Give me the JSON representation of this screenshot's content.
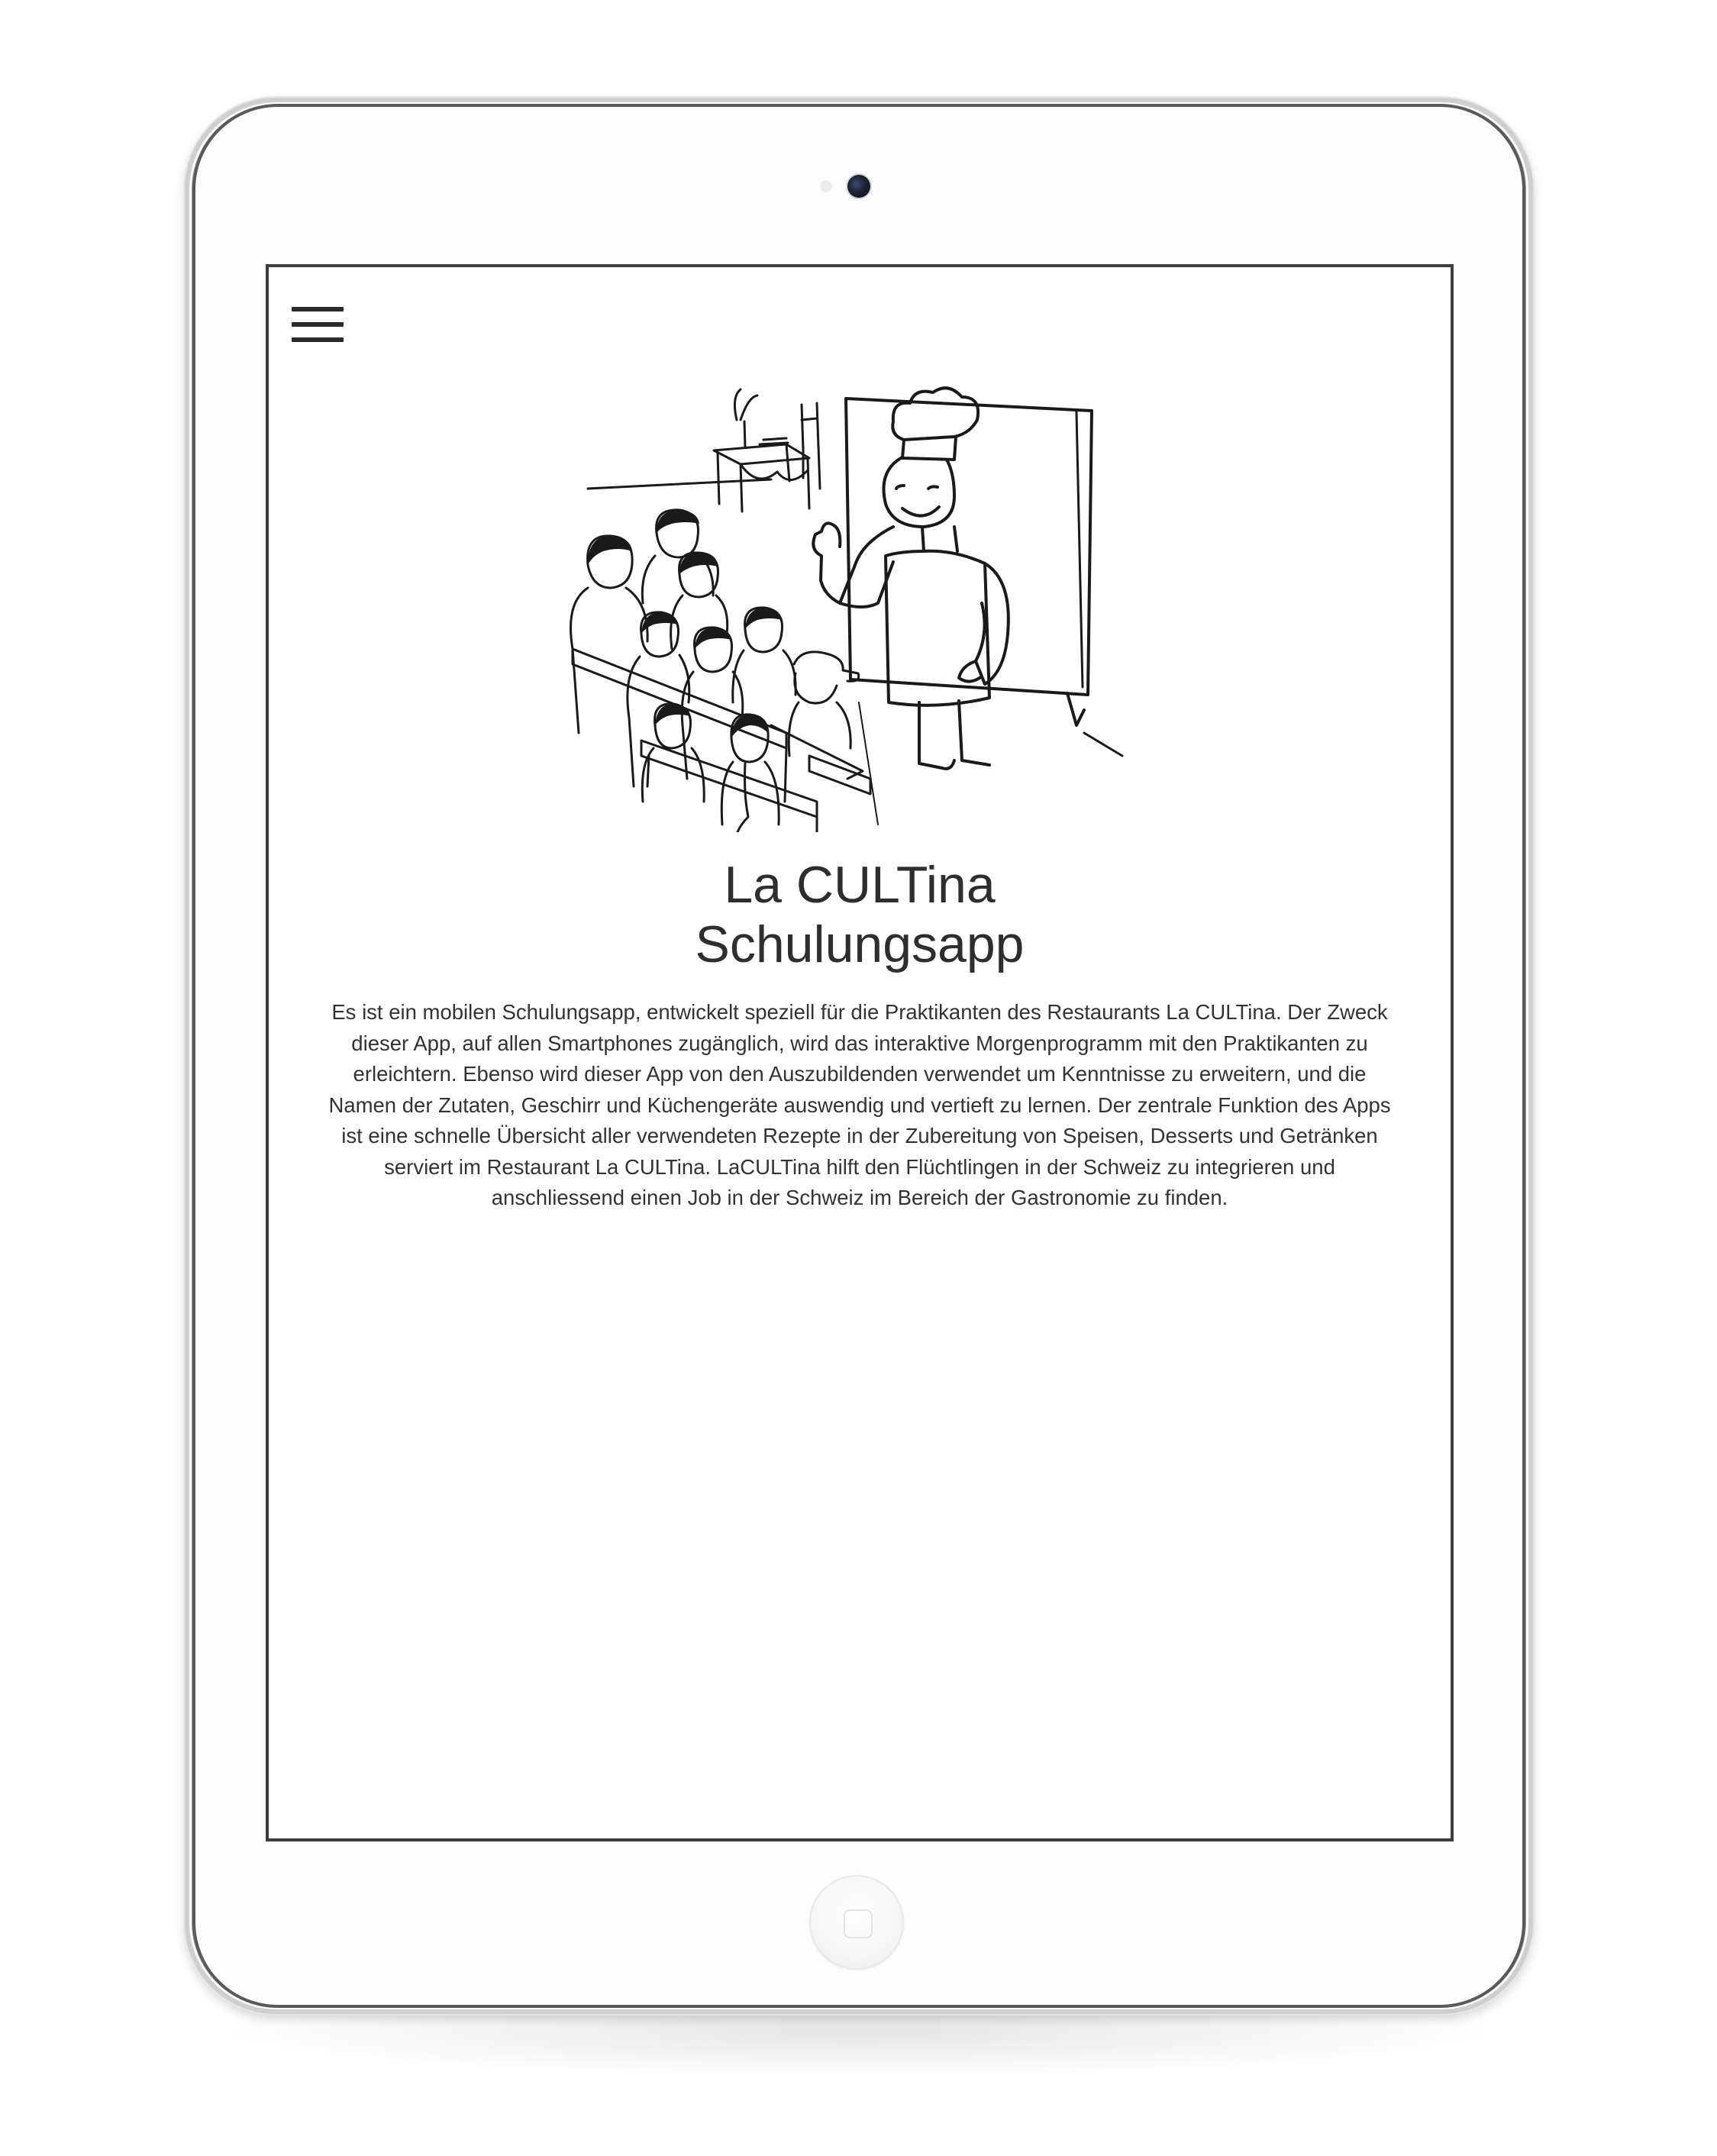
{
  "device": {
    "type": "tablet",
    "frame_color": "#fdfdfd",
    "screen_border_color": "#3d3d3d"
  },
  "app": {
    "menu_icon": "hamburger-menu-icon",
    "hero_image": "cartoon chef teaching a class of trainees",
    "title_line1": "La CULTina",
    "title_line2": "Schulungsapp",
    "description_lines": [
      "Es ist ein mobilen Schulungsapp, entwickelt speziell für die Praktikanten des Restaurants La CULTina. Der Zweck",
      "dieser App, auf allen Smartphones zugänglich, wird das interaktive Morgenprogramm mit den Praktikanten zu",
      "erleichtern. Ebenso wird dieser App von den Auszubildenden verwendet um Kenntnisse zu erweitern, und die",
      "Namen der Zutaten, Geschirr und Küchengeräte auswendig und vertieft zu lernen. Der zentrale Funktion des Apps",
      "ist eine schnelle Übersicht aller verwendeten Rezepte in der Zubereitung von Speisen, Desserts und Getränken",
      "serviert im Restaurant La CULTina. LaCULTina hilft den Flüchtlingen in der Schweiz zu integrieren und",
      "anschliessend einen Job in der Schweiz im Bereich der Gastronomie zu finden."
    ]
  }
}
